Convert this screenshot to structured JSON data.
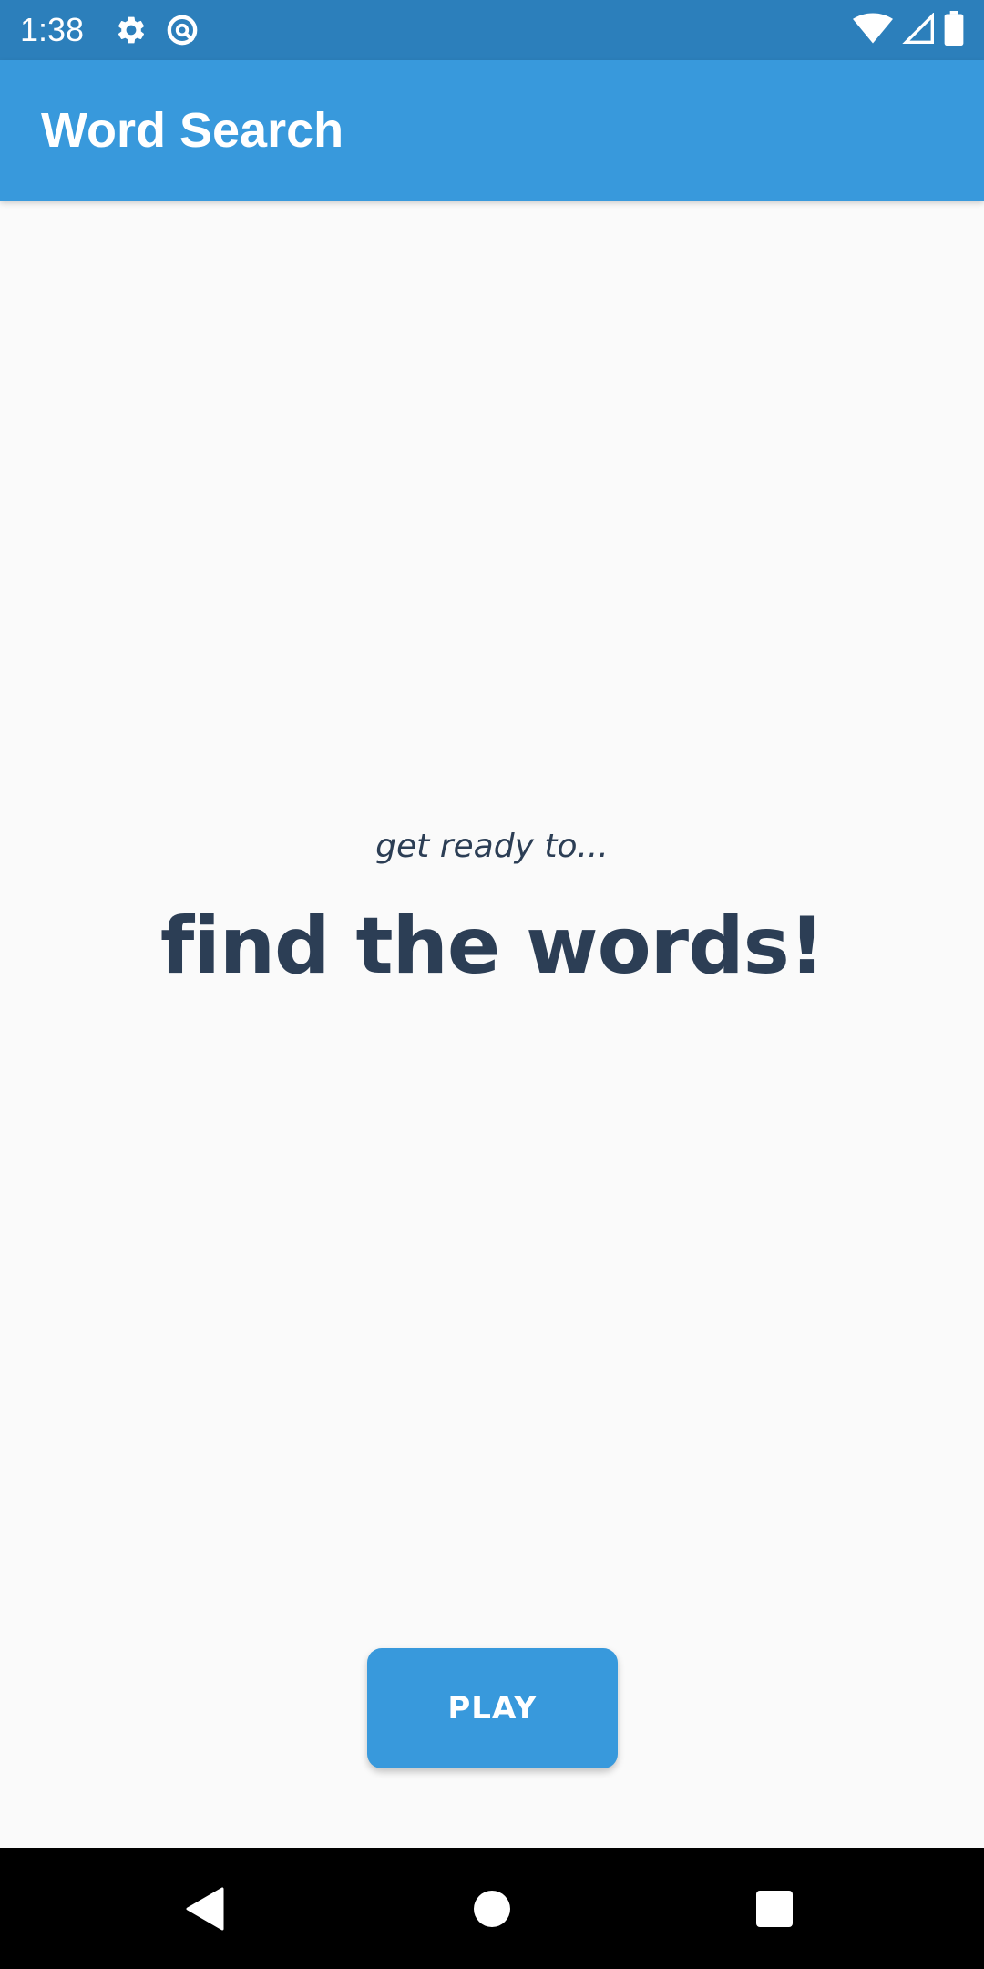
{
  "status_bar": {
    "time": "1:38",
    "icons": [
      "gear-icon",
      "data-saver-icon",
      "wifi-icon",
      "signal-icon",
      "battery-icon"
    ]
  },
  "app_bar": {
    "title": "Word Search"
  },
  "main": {
    "subtitle": "get ready to...",
    "headline": "find the words!",
    "play_label": "PLAY"
  },
  "nav_bar": {
    "icons": [
      "back-icon",
      "home-icon",
      "recents-icon"
    ]
  },
  "colors": {
    "status_bar": "#2c7fbb",
    "app_bar": "#3899dc",
    "accent": "#3899dc",
    "text_dark": "#2c3e55",
    "background": "#fafafa"
  }
}
